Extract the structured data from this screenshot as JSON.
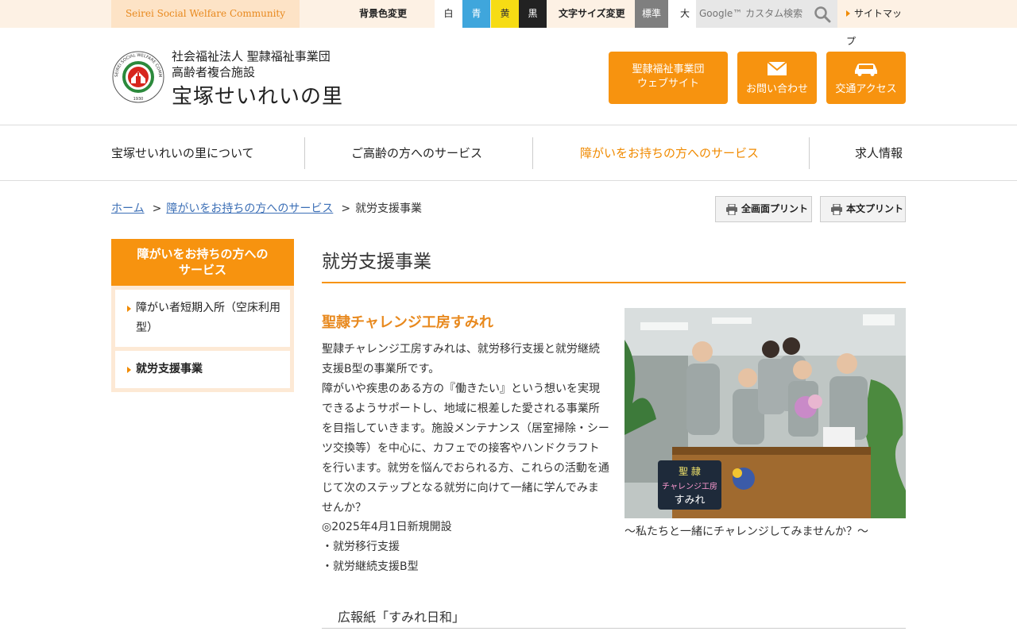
{
  "topbar": {
    "brand_tag": "Seirei Social Welfare Community",
    "bgcolor_label": "背景色変更",
    "bg_swatches": [
      "白",
      "青",
      "黄",
      "黒"
    ],
    "fontsize_label": "文字サイズ変更",
    "fontsize_options": [
      "標準",
      "大"
    ],
    "search_placeholder": "Google™ カスタム検索",
    "sitemap": "サイトマップ"
  },
  "header": {
    "org_line1": "社会福祉法人 聖隷福祉事業団",
    "org_line2": "高齢者複合施設",
    "site_title": "宝塚せいれいの里",
    "logo_ring_text": "SEIREI SOCIAL WELFARE COMMUNITY",
    "logo_year": "1930",
    "buttons": [
      {
        "line1": "聖隷福祉事業団",
        "line2": "ウェブサイト"
      },
      {
        "label": "お問い合わせ",
        "icon": "mail-icon"
      },
      {
        "label": "交通アクセス",
        "icon": "car-icon"
      }
    ]
  },
  "nav": {
    "items": [
      "宝塚せいれいの里について",
      "ご高齢の方へのサービス",
      "障がいをお持ちの方へのサービス",
      "求人情報"
    ],
    "active_index": 2
  },
  "breadcrumb": {
    "home": "ホーム",
    "parent": "障がいをお持ちの方へのサービス",
    "current": "就労支援事業",
    "separator": ">"
  },
  "print": {
    "full": "全画面プリント",
    "body": "本文プリント"
  },
  "sidebar": {
    "title_line1": "障がいをお持ちの方への",
    "title_line2": "サービス",
    "items": [
      "障がい者短期入所（空床利用型）",
      "就労支援事業"
    ],
    "active_index": 1
  },
  "main": {
    "page_title": "就労支援事業",
    "section_title": "聖隷チャレンジ工房すみれ",
    "paragraph1": "聖隷チャレンジ工房すみれは、就労移行支援と就労継続支援B型の事業所です。",
    "paragraph2": "障がいや疾患のある方の『働きたい』という想いを実現できるようサポートし、地域に根差した愛される事業所を目指していきます。施設メンテナンス（居室掃除・シーツ交換等）を中心に、カフェでの接客やハンドクラフトを行います。就労を悩んでおられる方、これらの活動を通じて次のステップとなる就労に向けて一緒に学んでみませんか？",
    "list": [
      "◎2025年4月1日新規開設",
      "・就労移行支援",
      "・就労継続支援B型"
    ],
    "photo_caption": "～私たちと一緒にチャレンジしてみませんか？～",
    "photo_sign_line1": "聖 隷",
    "photo_sign_line2": "チャレンジ工房",
    "photo_sign_line3": "すみれ",
    "sub_heading": "広報紙「すみれ日和」"
  },
  "colors": {
    "accent": "#f7930f",
    "accent_text": "#e8891e",
    "link": "#3c6fb6",
    "top_bar_bg": "#fdf1e4"
  }
}
